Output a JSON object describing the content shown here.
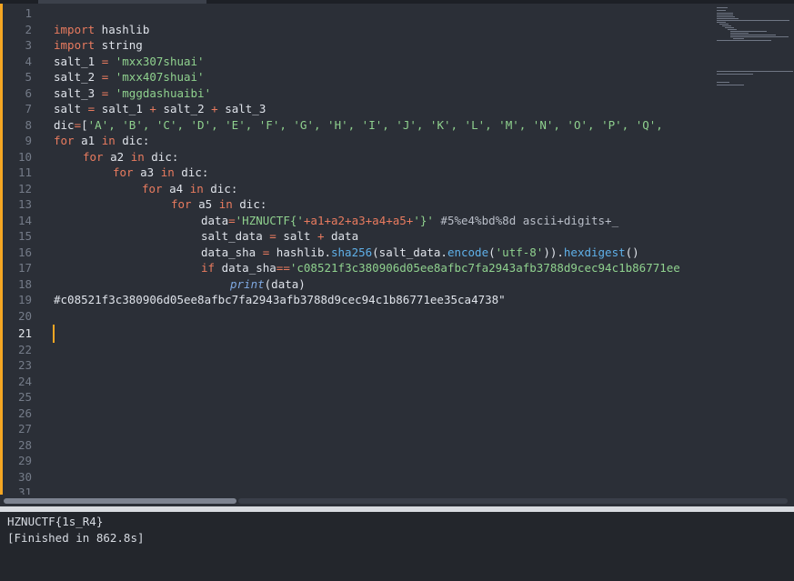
{
  "editor": {
    "line_numbers": [
      "1",
      "2",
      "3",
      "4",
      "5",
      "6",
      "7",
      "8",
      "9",
      "10",
      "11",
      "12",
      "13",
      "14",
      "15",
      "16",
      "17",
      "18",
      "19",
      "20",
      "21",
      "22",
      "23",
      "24",
      "25",
      "26",
      "27",
      "28",
      "29",
      "30",
      "31"
    ],
    "active_line": "21",
    "code": {
      "l2_kw": "import",
      "l2_rest": " hashlib",
      "l3_kw": "import",
      "l3_rest": " string",
      "l4_a": "salt_1 ",
      "l4_op": "=",
      "l4_str": " 'mxx307shuai'",
      "l5_a": "salt_2 ",
      "l5_op": "=",
      "l5_str": " 'mxx407shuai'",
      "l6_a": "salt_3 ",
      "l6_op": "=",
      "l6_str": " 'mggdashuaibi'",
      "l7_a": "salt ",
      "l7_op1": "=",
      "l7_b": " salt_1 ",
      "l7_op2": "+",
      "l7_c": " salt_2 ",
      "l7_op3": "+",
      "l7_d": " salt_3",
      "l8_a": "dic",
      "l8_op": "=",
      "l8_b": "[",
      "l8_str": "'A', 'B', 'C', 'D', 'E', 'F', 'G', 'H', 'I', 'J', 'K', 'L', 'M', 'N', 'O', 'P', 'Q',",
      "l9_kw1": "for",
      "l9_b": " a1 ",
      "l9_kw2": "in",
      "l9_c": " dic:",
      "l10_kw1": "for",
      "l10_b": " a2 ",
      "l10_kw2": "in",
      "l10_c": " dic:",
      "l11_kw1": "for",
      "l11_b": " a3 ",
      "l11_kw2": "in",
      "l11_c": " dic:",
      "l12_kw1": "for",
      "l12_b": " a4 ",
      "l12_kw2": "in",
      "l12_c": " dic:",
      "l13_kw1": "for",
      "l13_b": " a5 ",
      "l13_kw2": "in",
      "l13_c": " dic:",
      "l14_a": "data",
      "l14_op": "=",
      "l14_str1": "'HZNUCTF{'",
      "l14_op2": "+a1+a2+a3+a4+a5+",
      "l14_str2": "'}'",
      "l14_cm": " #5%e4%bd%8d ascii+digits+_",
      "l15_a": "salt_data ",
      "l15_op": "=",
      "l15_b": " salt ",
      "l15_op2": "+",
      "l15_c": " data",
      "l16_a": "data_sha ",
      "l16_op": "=",
      "l16_b": " hashlib.",
      "l16_fn1": "sha256",
      "l16_c": "(salt_data.",
      "l16_fn2": "encode",
      "l16_d": "(",
      "l16_str": "'utf-8'",
      "l16_e": ")).",
      "l16_fn3": "hexdigest",
      "l16_f": "()",
      "l17_kw": "if",
      "l17_b": " data_sha",
      "l17_op": "==",
      "l17_str": "'c08521f3c380906d05ee8afbc7fa2943afb3788d9cec94c1b86771ee",
      "l18_fn": "print",
      "l18_b": "(data)",
      "l19_text": "#c08521f3c380906d05ee8afbc7fa2943afb3788d9cec94c1b86771ee35ca4738\""
    }
  },
  "console": {
    "output_line1": "HZNUCTF{1s_R4}",
    "output_line2": "[Finished in 862.8s]"
  },
  "colors": {
    "accent": "#f5a623",
    "keyword": "#e97b5f",
    "string": "#8fd18e",
    "function": "#5fb0e8",
    "background": "#2b2f37"
  }
}
